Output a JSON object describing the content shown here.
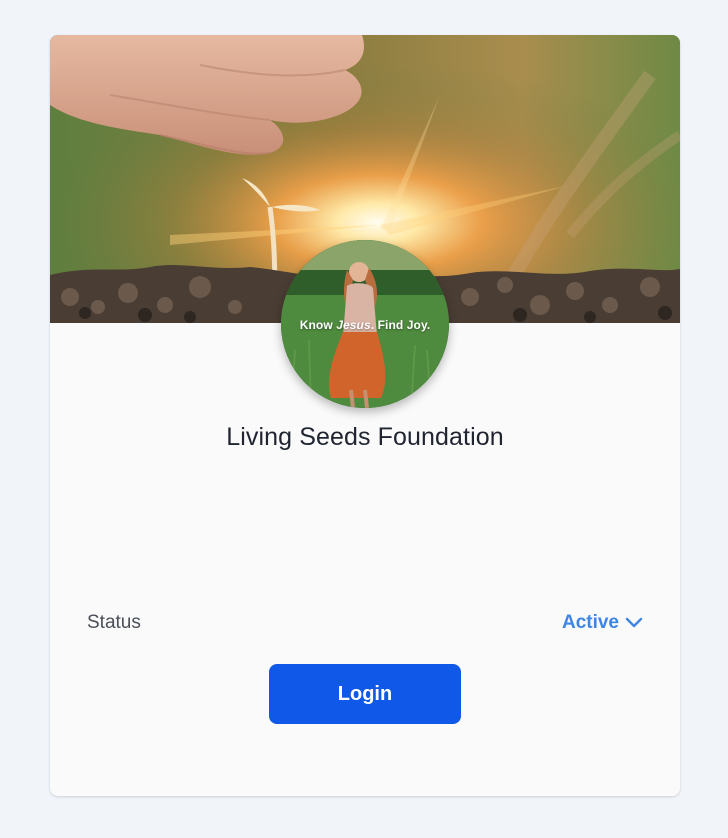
{
  "organization": {
    "name": "Living Seeds Foundation",
    "banner_icon": "seedling-sunrise-banner",
    "avatar_icon": "profile-photo"
  },
  "avatar": {
    "caption_part1": "Know ",
    "caption_italic": "Jesus",
    "caption_part2": ". Find Joy."
  },
  "status": {
    "label": "Status",
    "value": "Active",
    "value_color": "#3f86e4"
  },
  "actions": {
    "login_label": "Login",
    "login_color": "#1058e8"
  }
}
